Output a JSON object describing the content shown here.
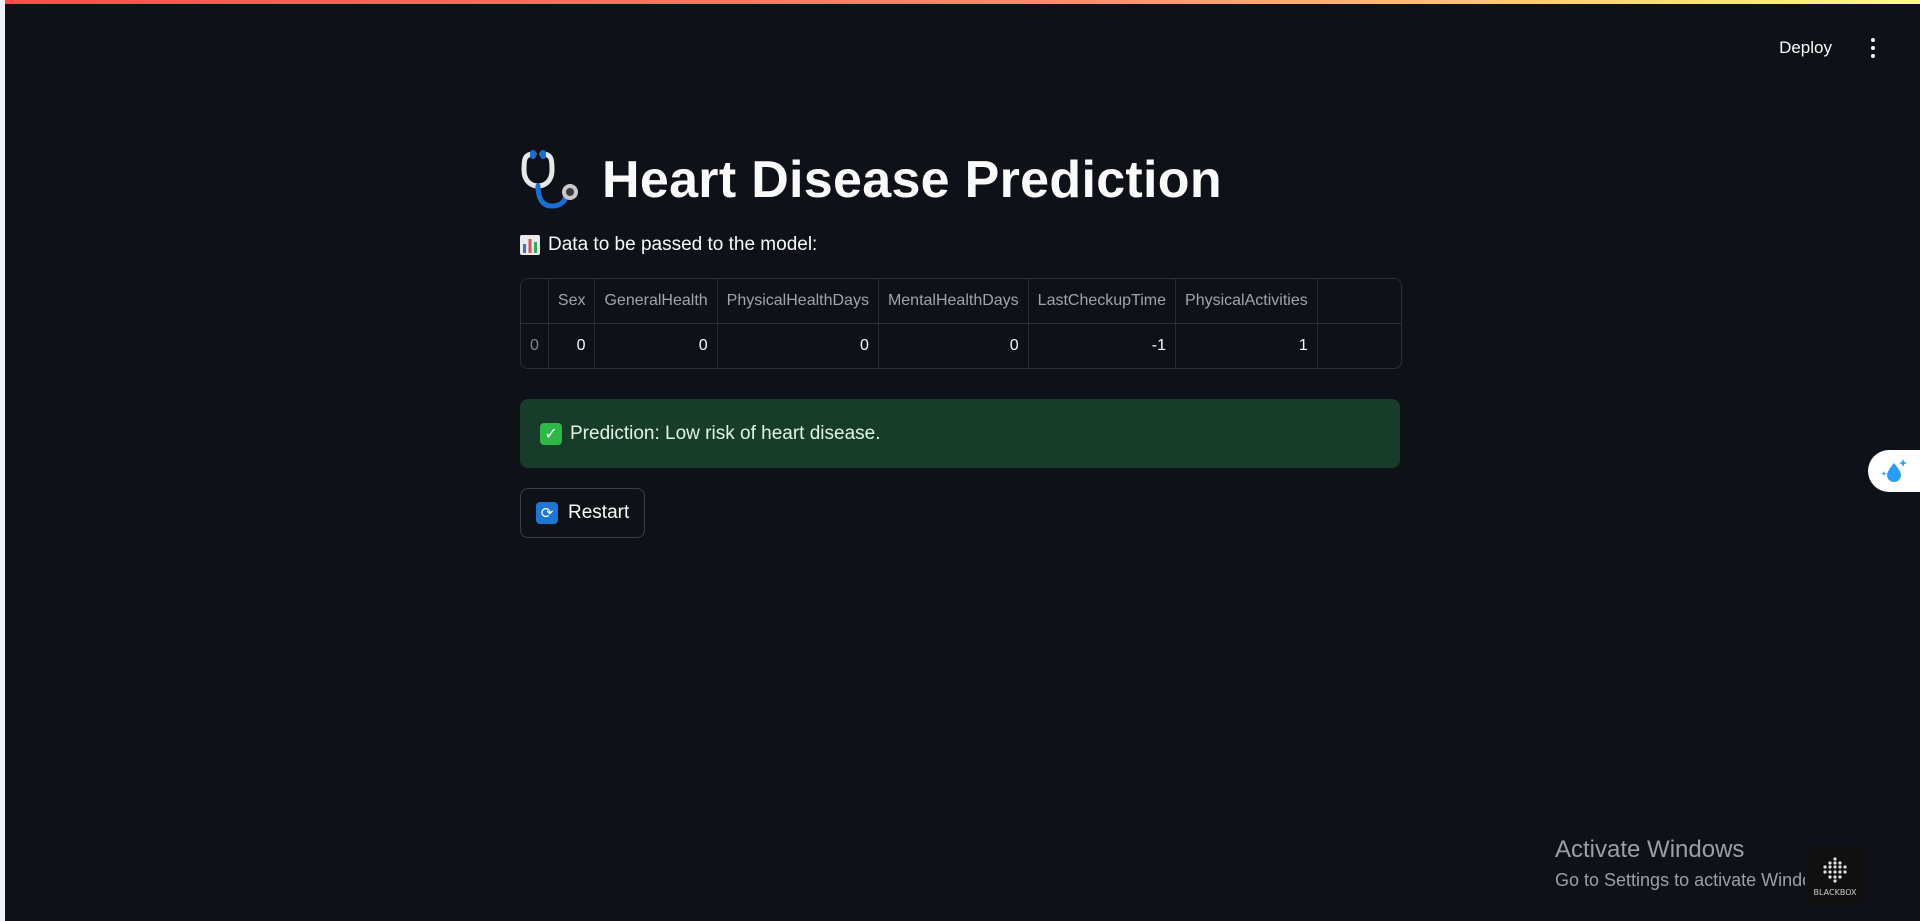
{
  "header": {
    "deploy_label": "Deploy",
    "menu_icon": "kebab-menu-icon"
  },
  "main": {
    "title": "Heart Disease Prediction",
    "title_icon": "stethoscope-icon",
    "subheader": "Data to be passed to the model:",
    "subheader_icon": "bar-chart-icon",
    "table": {
      "columns": [
        "",
        "Sex",
        "GeneralHealth",
        "PhysicalHealthDays",
        "MentalHealthDays",
        "LastCheckupTime",
        "PhysicalActivities"
      ],
      "rows": [
        [
          "0",
          "0",
          "0",
          "0",
          "0",
          "-1",
          "1"
        ]
      ]
    },
    "alert": {
      "icon": "check-mark-icon",
      "text": "Prediction: Low risk of heart disease.",
      "background": "#183c2a"
    },
    "restart_button": {
      "icon": "refresh-icon",
      "label": "Restart"
    }
  },
  "overlay": {
    "activate_title": "Activate Windows",
    "activate_subtitle": "Go to Settings to activate Windows.",
    "logo_text": "BLACKBOX"
  },
  "colors": {
    "background": "#0e1117",
    "text": "#fafafa",
    "accent_gradient_start": "#ff4b4b",
    "accent_gradient_end": "#fffd80",
    "success": "#2eb845"
  }
}
